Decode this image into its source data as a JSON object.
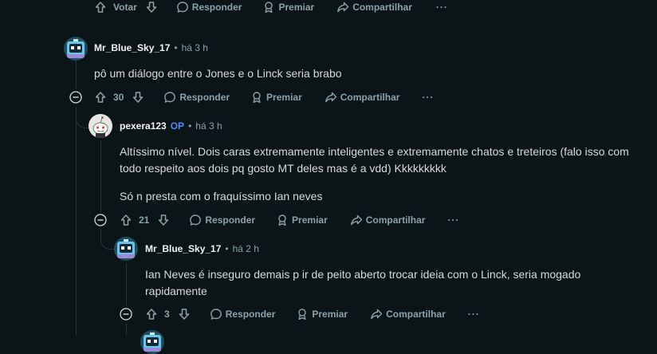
{
  "top_actions": {
    "vote_label": "Votar",
    "reply_label": "Responder",
    "award_label": "Premiar",
    "share_label": "Compartilhar",
    "more_label": "···"
  },
  "comments": [
    {
      "author": "Mr_Blue_Sky_17",
      "separator": "•",
      "time": "há 3 h",
      "paragraphs": [
        "pô um diálogo entre o Jones e o Linck seria brabo"
      ],
      "score": "30",
      "reply_label": "Responder",
      "award_label": "Premiar",
      "share_label": "Compartilhar",
      "more_label": "···"
    },
    {
      "author": "pexera123",
      "op_badge": "OP",
      "separator": "•",
      "time": "há 3 h",
      "paragraphs": [
        "Altíssimo nível. Dois caras extremamente inteligentes e extremamente chatos e treteiros (falo isso com todo respeito aos dois pq gosto MT deles mas é a vdd) Kkkkkkkkk",
        "Só n presta com o fraquíssimo Ian neves"
      ],
      "score": "21",
      "reply_label": "Responder",
      "award_label": "Premiar",
      "share_label": "Compartilhar",
      "more_label": "···"
    },
    {
      "author": "Mr_Blue_Sky_17",
      "separator": "•",
      "time": "há 2 h",
      "paragraphs": [
        "Ian Neves é inseguro demais p ir de peito aberto trocar ideia com o Linck, seria mogado rapidamente"
      ],
      "score": "3",
      "reply_label": "Responder",
      "award_label": "Premiar",
      "share_label": "Compartilhar",
      "more_label": "···"
    }
  ],
  "icons": {
    "upvote": "arrow-up-icon",
    "downvote": "arrow-down-icon",
    "reply": "speech-bubble-icon",
    "award": "award-ribbon-icon",
    "share": "share-arrow-icon",
    "collapse": "minus-circle-icon"
  },
  "colors": {
    "background": "#0b1416",
    "text": "#d7dadc",
    "muted": "#8ba2ad",
    "op_badge": "#4f8cff",
    "thread_line": "#2a3236"
  }
}
